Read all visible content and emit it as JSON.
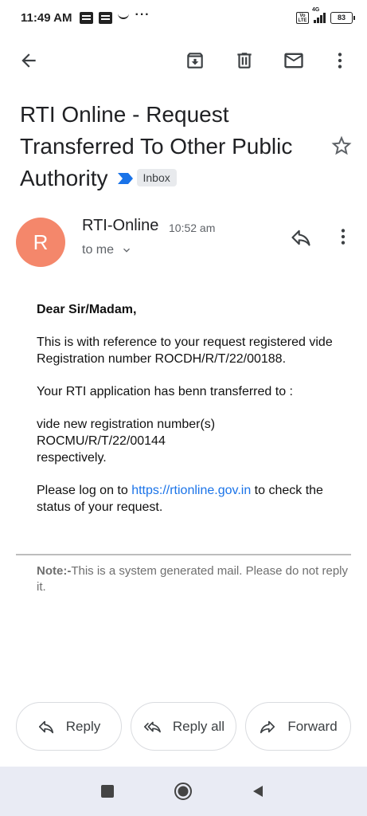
{
  "status_bar": {
    "time": "11:49 AM",
    "volte": "Vo LTE",
    "network": "4G",
    "battery": "83"
  },
  "toolbar": {
    "back_icon": "arrow-back-icon",
    "archive_icon": "archive-icon",
    "delete_icon": "delete-icon",
    "mark_unread_icon": "mail-icon",
    "more_icon": "more-vert-icon"
  },
  "email": {
    "subject": "RTI Online - Request Transferred To Other Public Authority",
    "label": "Inbox",
    "importance_color": "#1a73e8",
    "sender": {
      "initial": "R",
      "avatar_color": "#f4876b",
      "name": "RTI-Online",
      "time": "10:52 am",
      "recipient": "to me"
    },
    "body": {
      "greeting": "Dear Sir/Madam,",
      "para1": "This is with reference to your request registered vide Registration number ROCDH/R/T/22/00188.",
      "para2": "Your RTI application has benn transferred to :",
      "para3_line1": "vide new registration number(s)",
      "para3_line2": "ROCMU/R/T/22/00144",
      "para3_line3": "respectively.",
      "para4_before": "Please log on to ",
      "para4_link": "https://rtionline.gov.in",
      "para4_after": " to check the status of your request."
    },
    "note_label": "Note:-",
    "note_text": "This is a system generated mail. Please do not reply it."
  },
  "actions": {
    "reply": "Reply",
    "reply_all": "Reply all",
    "forward": "Forward"
  }
}
